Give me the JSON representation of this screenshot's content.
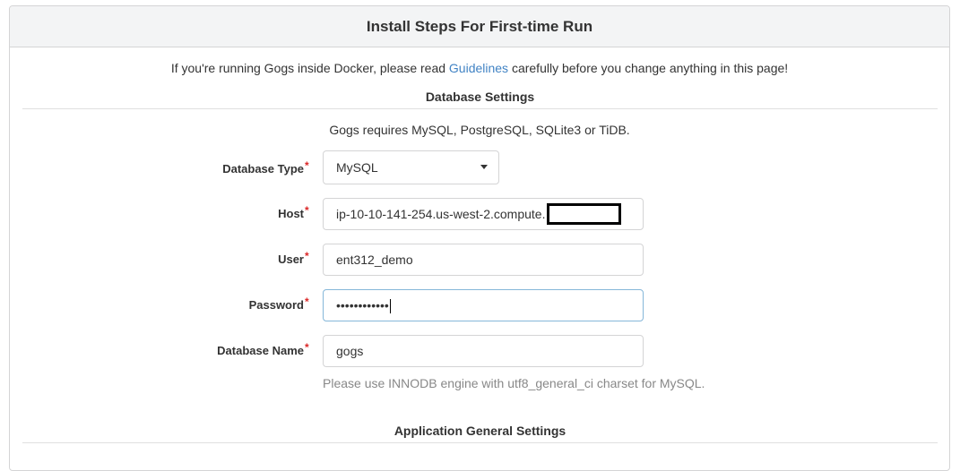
{
  "header": {
    "title": "Install Steps For First-time Run"
  },
  "notice": {
    "before": "If you're running Gogs inside Docker, please read ",
    "link": "Guidelines",
    "after": " carefully before you change anything in this page!"
  },
  "database": {
    "section_title": "Database Settings",
    "requires_text": "Gogs requires MySQL, PostgreSQL, SQLite3 or TiDB.",
    "type": {
      "label": "Database Type",
      "required_mark": "*",
      "value": "MySQL"
    },
    "host": {
      "label": "Host",
      "required_mark": "*",
      "value": "ip-10-10-141-254.us-west-2.compute."
    },
    "user": {
      "label": "User",
      "required_mark": "*",
      "value": "ent312_demo"
    },
    "password": {
      "label": "Password",
      "required_mark": "*",
      "value": "••••••••••••"
    },
    "name": {
      "label": "Database Name",
      "required_mark": "*",
      "value": "gogs"
    },
    "help_text": "Please use INNODB engine with utf8_general_ci charset for MySQL."
  },
  "app": {
    "section_title": "Application General Settings"
  },
  "colors": {
    "link": "#4183c4",
    "required": "#db2828",
    "focus_border": "#85b7d9",
    "help_text": "#888888"
  }
}
